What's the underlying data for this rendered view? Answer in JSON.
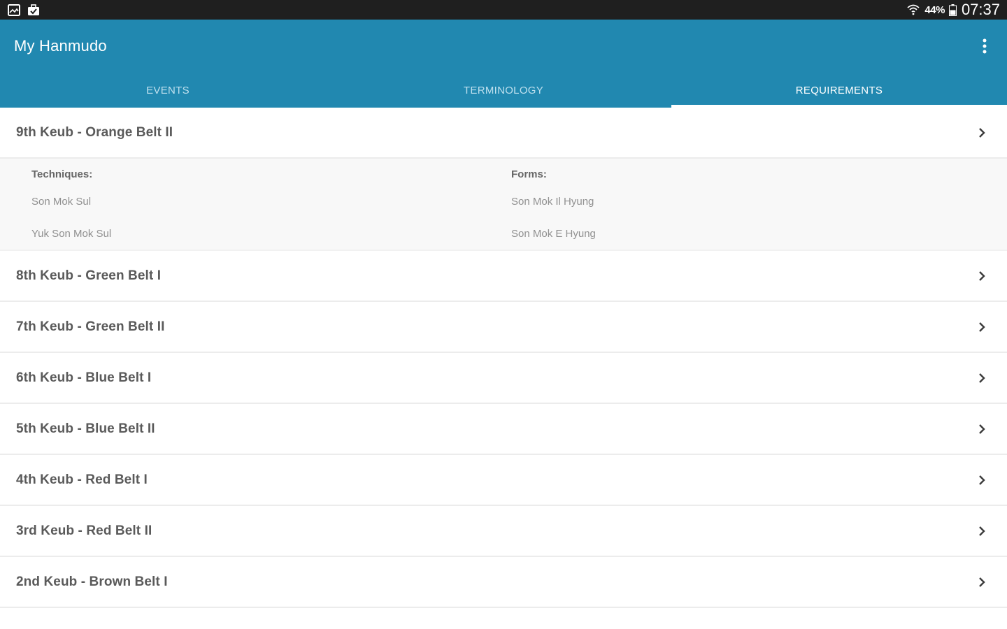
{
  "status_bar": {
    "left_icons": [
      "gallery-icon",
      "briefcase-icon"
    ],
    "battery_percent": "44%",
    "time": "07:37"
  },
  "app_bar": {
    "title": "My Hanmudo",
    "tabs": [
      {
        "label": "EVENTS",
        "active": false
      },
      {
        "label": "TERMINOLOGY",
        "active": false
      },
      {
        "label": "REQUIREMENTS",
        "active": true
      }
    ]
  },
  "requirements": {
    "expanded": {
      "title": "9th Keub - Orange Belt II",
      "techniques_label": "Techniques:",
      "techniques": [
        "Son Mok Sul",
        "Yuk Son Mok Sul"
      ],
      "forms_label": "Forms:",
      "forms": [
        "Son Mok Il Hyung",
        "Son Mok E Hyung"
      ]
    },
    "items": [
      {
        "label": "8th Keub - Green Belt I"
      },
      {
        "label": "7th Keub - Green Belt II"
      },
      {
        "label": "6th Keub - Blue Belt I"
      },
      {
        "label": "5th Keub - Blue Belt II"
      },
      {
        "label": "4th Keub - Red Belt I"
      },
      {
        "label": "3rd Keub - Red Belt II"
      },
      {
        "label": "2nd Keub - Brown Belt I"
      }
    ]
  },
  "colors": {
    "app_bar": "#2188b0",
    "status_bar": "#1f1f1f",
    "row_text": "#5a5a5a",
    "detail_text": "#909090"
  }
}
